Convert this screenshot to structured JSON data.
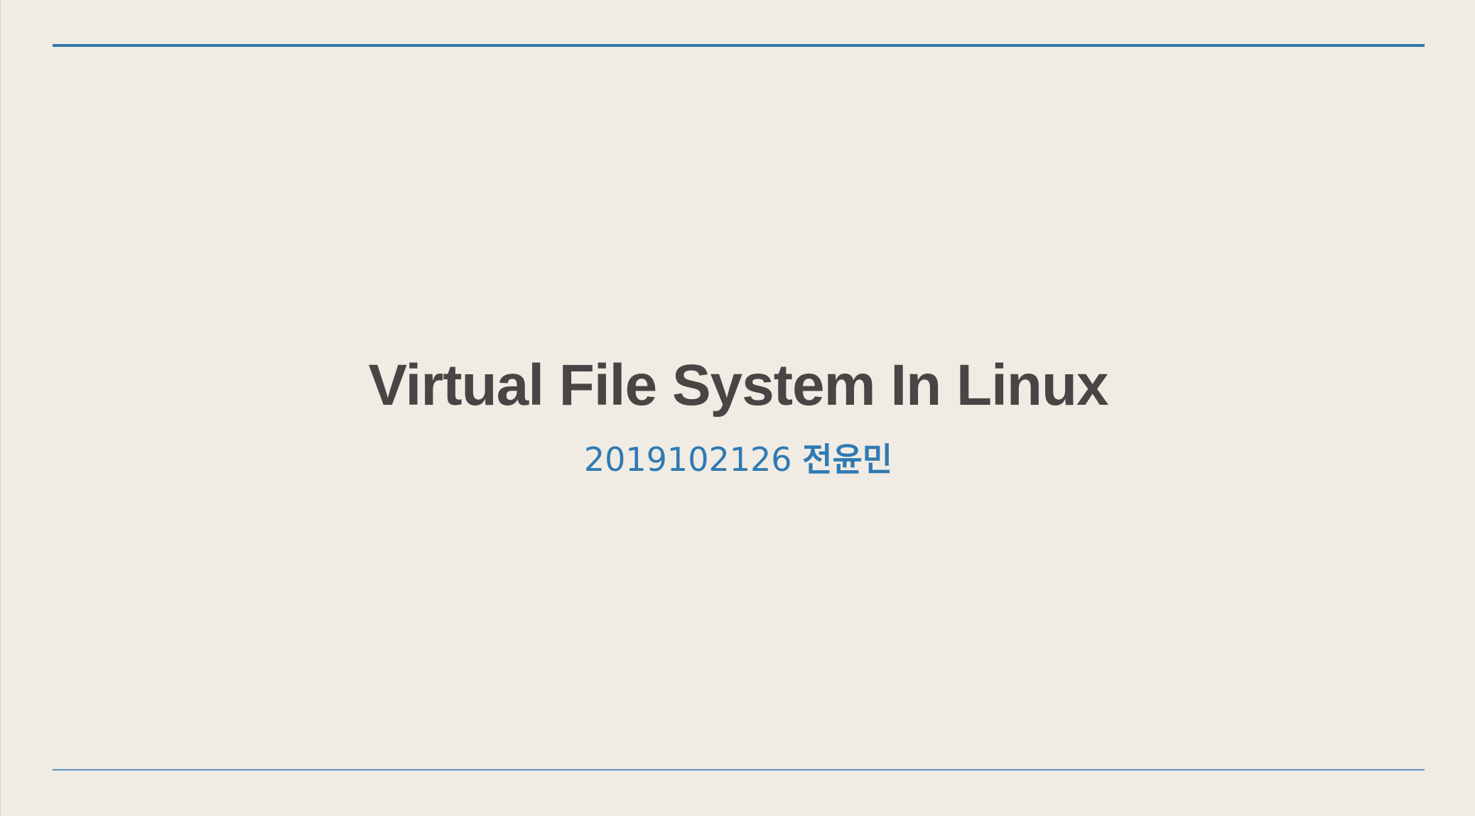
{
  "slide": {
    "title": "Virtual File System In Linux",
    "student_id": "2019102126",
    "student_name": "전윤민"
  },
  "colors": {
    "background": "#f0ece3",
    "accent": "#2f78ad",
    "title_text": "#474645",
    "subtitle_text": "#2e7ab4"
  }
}
